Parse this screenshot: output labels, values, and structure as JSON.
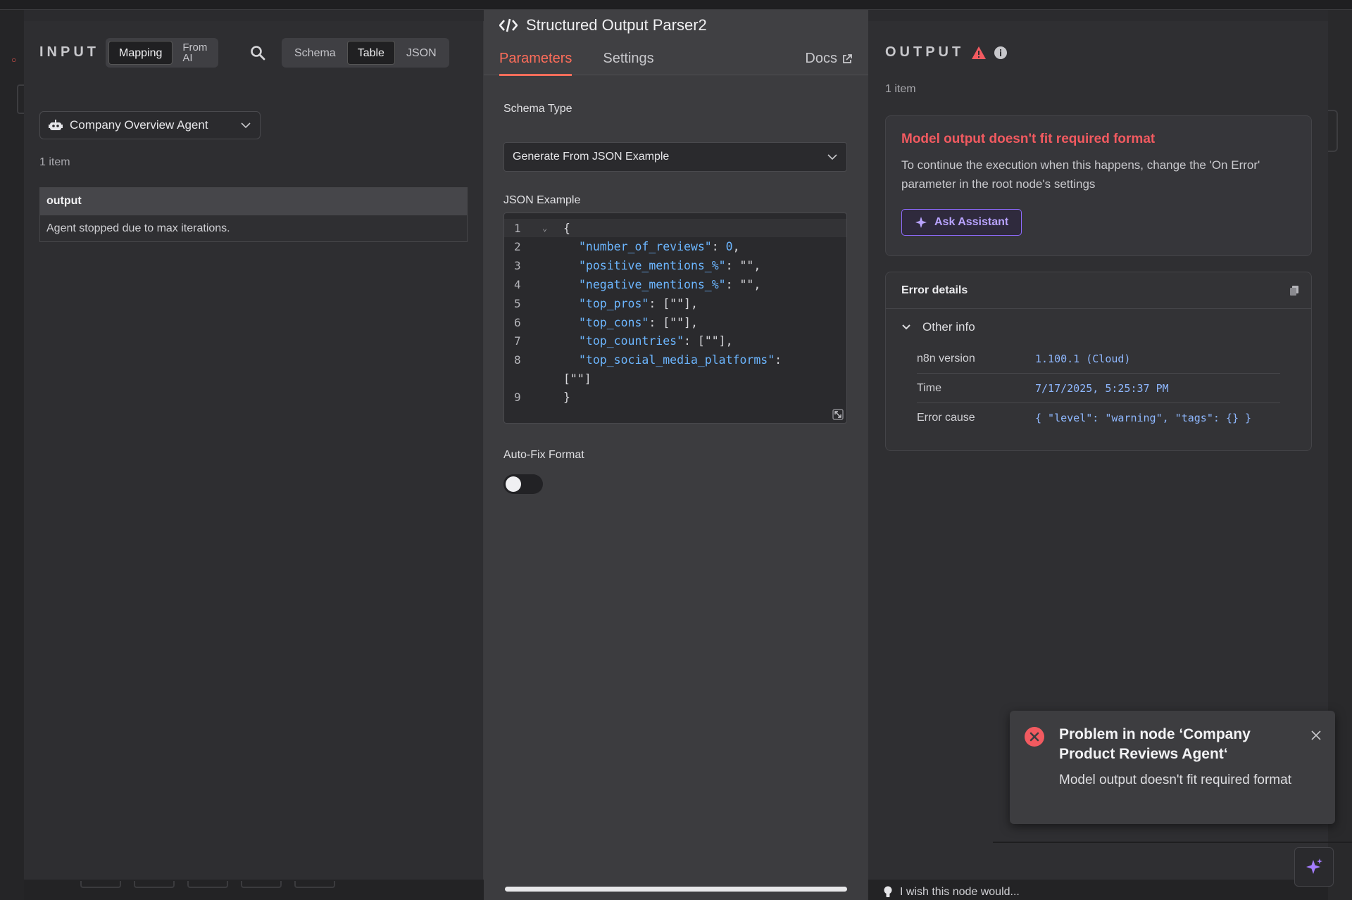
{
  "input": {
    "label": "INPUT",
    "mode_tabs": [
      {
        "label": "Mapping",
        "active": true
      },
      {
        "label_line1": "From",
        "label_line2": "AI",
        "active": false
      }
    ],
    "view_tabs": [
      {
        "label": "Schema",
        "active": false
      },
      {
        "label": "Table",
        "active": true
      },
      {
        "label": "JSON",
        "active": false
      }
    ],
    "node_select": "Company Overview Agent",
    "item_count": "1 item",
    "table": {
      "header": "output",
      "value": "Agent stopped due to max iterations."
    }
  },
  "parameters": {
    "title": "Structured Output Parser2",
    "tabs": [
      {
        "label": "Parameters",
        "active": true
      },
      {
        "label": "Settings",
        "active": false
      }
    ],
    "docs_label": "Docs",
    "schema_type_label": "Schema Type",
    "schema_type_value": "Generate From JSON Example",
    "json_example_label": "JSON Example",
    "code_lines": [
      {
        "n": "1",
        "text": "{"
      },
      {
        "n": "2",
        "key": "\"number_of_reviews\"",
        "rest": ": ",
        "num": "0",
        "tail": ","
      },
      {
        "n": "3",
        "key": "\"positive_mentions_%\"",
        "rest": ": \"\","
      },
      {
        "n": "4",
        "key": "\"negative_mentions_%\"",
        "rest": ": \"\","
      },
      {
        "n": "5",
        "key": "\"top_pros\"",
        "rest": ": [\"\"],"
      },
      {
        "n": "6",
        "key": "\"top_cons\"",
        "rest": ": [\"\"],"
      },
      {
        "n": "7",
        "key": "\"top_countries\"",
        "rest": ": [\"\"],"
      },
      {
        "n": "8",
        "key": "\"top_social_media_platforms\"",
        "rest": ":"
      },
      {
        "n": "",
        "text": "[\"\"]"
      },
      {
        "n": "9",
        "text": "}"
      }
    ],
    "auto_fix_label": "Auto-Fix Format",
    "auto_fix_on": false
  },
  "output": {
    "label": "OUTPUT",
    "item_count": "1 item",
    "error_title": "Model output doesn't fit required format",
    "error_message": "To continue the execution when this happens, change the 'On Error' parameter in the root node's settings",
    "ask_button": "Ask Assistant",
    "details_title": "Error details",
    "other_info_label": "Other info",
    "info": [
      {
        "key": "n8n version",
        "value": "1.100.1 (Cloud)"
      },
      {
        "key": "Time",
        "value": "7/17/2025, 5:25:37 PM"
      },
      {
        "key": "Error cause",
        "value": "{ \"level\": \"warning\", \"tags\": {} }"
      }
    ]
  },
  "toast": {
    "title": "Problem in node ‘Company Product Reviews Agent‘",
    "message": "Model output doesn't fit required format"
  },
  "feedback": "I wish this node would...",
  "colors": {
    "accent": "#ff6d5a",
    "error": "#f25a60",
    "assistant": "#8f6bff"
  }
}
